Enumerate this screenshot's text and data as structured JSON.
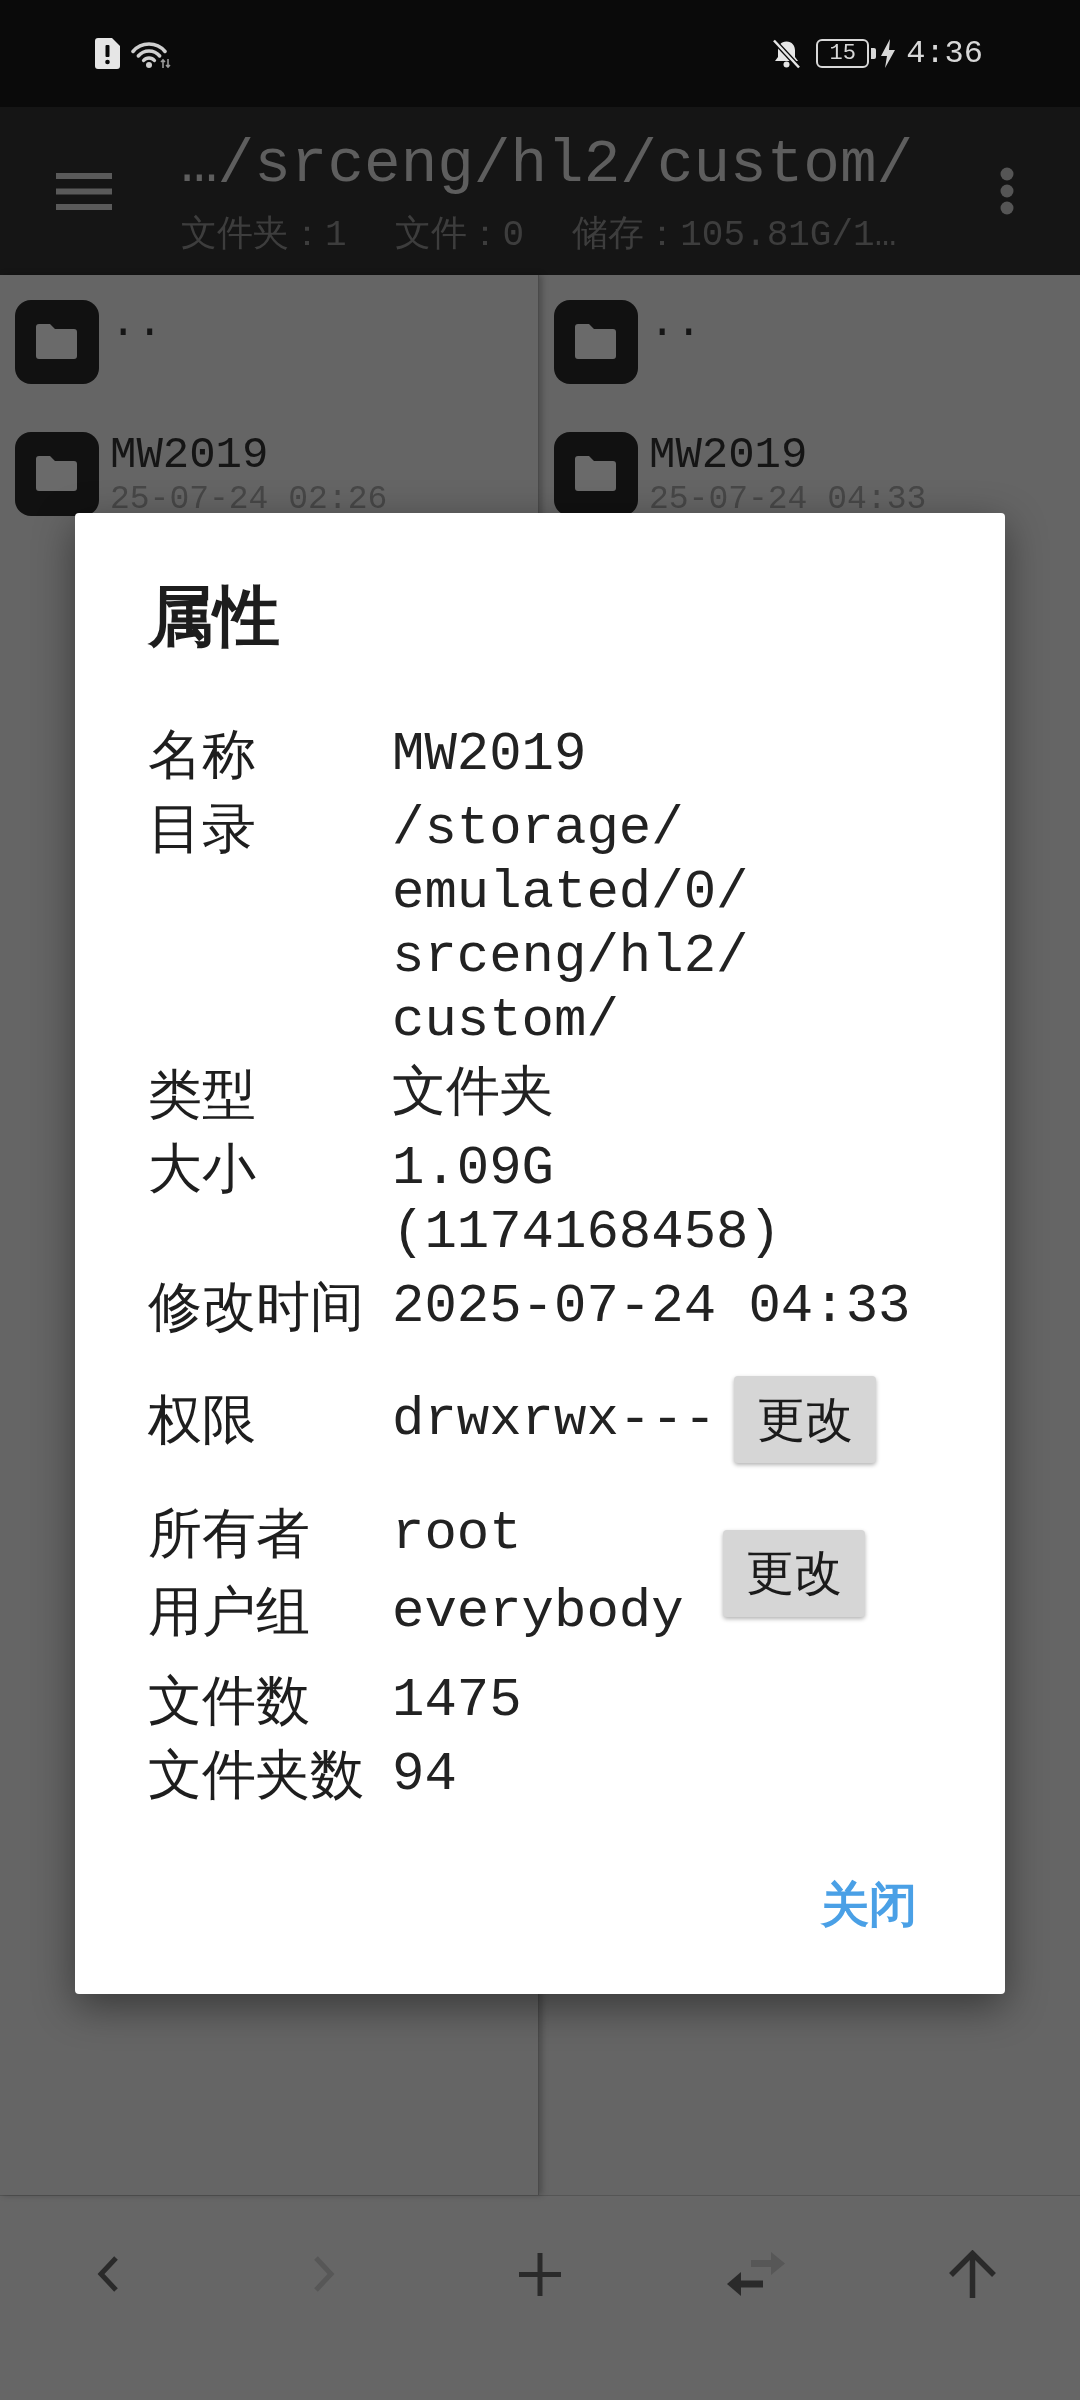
{
  "status_bar": {
    "battery": "15",
    "time": "4:36"
  },
  "toolbar": {
    "path": "…/srceng/hl2/custom/",
    "stats": [
      "文件夹：1",
      "文件：0",
      "储存：105.81G/1…"
    ]
  },
  "panes": [
    {
      "items": [
        {
          "name": ".."
        },
        {
          "name": "MW2019",
          "modified": "25-07-24 02:26"
        }
      ]
    },
    {
      "items": [
        {
          "name": ".."
        },
        {
          "name": "MW2019",
          "modified": "25-07-24 04:33"
        }
      ]
    }
  ],
  "dialog": {
    "title": "属性",
    "rows": [
      {
        "kind": "text",
        "label": "名称",
        "value": "MW2019"
      },
      {
        "kind": "text",
        "label": "目录",
        "value": "/storage/emulated/0/srceng/hl2/custom/"
      },
      {
        "kind": "text",
        "label": "类型",
        "value": "文件夹"
      },
      {
        "kind": "text",
        "label": "大小",
        "value": "1.09G (1174168458)"
      },
      {
        "kind": "text",
        "label": "修改时间",
        "value": "2025-07-24 04:33"
      },
      {
        "kind": "action",
        "label": "权限",
        "value": "drwxrwx---",
        "button": "更改"
      },
      {
        "kind": "group",
        "fields": [
          {
            "label": "所有者",
            "value": "root"
          },
          {
            "label": "用户组",
            "value": "everybody"
          }
        ],
        "button": "更改"
      },
      {
        "kind": "text",
        "label": "文件数",
        "value": "1475"
      },
      {
        "kind": "text",
        "label": "文件夹数",
        "value": "94"
      }
    ],
    "close_button": "关闭"
  },
  "bottom_bar": {
    "buttons": [
      {
        "kind": "back",
        "disabled": false
      },
      {
        "kind": "forward",
        "disabled": true
      },
      {
        "kind": "add",
        "disabled": false
      },
      {
        "kind": "swap",
        "disabled": false
      },
      {
        "kind": "up",
        "disabled": false
      }
    ]
  }
}
